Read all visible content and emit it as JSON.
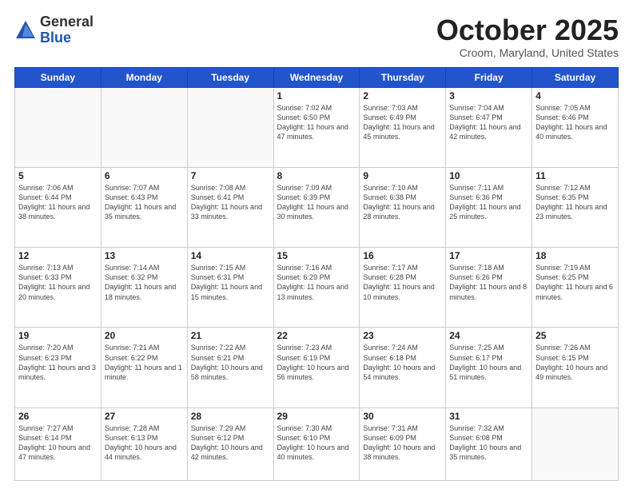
{
  "header": {
    "logo_general": "General",
    "logo_blue": "Blue",
    "title": "October 2025",
    "subtitle": "Croom, Maryland, United States"
  },
  "days_of_week": [
    "Sunday",
    "Monday",
    "Tuesday",
    "Wednesday",
    "Thursday",
    "Friday",
    "Saturday"
  ],
  "weeks": [
    [
      {
        "num": "",
        "info": ""
      },
      {
        "num": "",
        "info": ""
      },
      {
        "num": "",
        "info": ""
      },
      {
        "num": "1",
        "info": "Sunrise: 7:02 AM\nSunset: 6:50 PM\nDaylight: 11 hours and 47 minutes."
      },
      {
        "num": "2",
        "info": "Sunrise: 7:03 AM\nSunset: 6:49 PM\nDaylight: 11 hours and 45 minutes."
      },
      {
        "num": "3",
        "info": "Sunrise: 7:04 AM\nSunset: 6:47 PM\nDaylight: 11 hours and 42 minutes."
      },
      {
        "num": "4",
        "info": "Sunrise: 7:05 AM\nSunset: 6:46 PM\nDaylight: 11 hours and 40 minutes."
      }
    ],
    [
      {
        "num": "5",
        "info": "Sunrise: 7:06 AM\nSunset: 6:44 PM\nDaylight: 11 hours and 38 minutes."
      },
      {
        "num": "6",
        "info": "Sunrise: 7:07 AM\nSunset: 6:43 PM\nDaylight: 11 hours and 35 minutes."
      },
      {
        "num": "7",
        "info": "Sunrise: 7:08 AM\nSunset: 6:41 PM\nDaylight: 11 hours and 33 minutes."
      },
      {
        "num": "8",
        "info": "Sunrise: 7:09 AM\nSunset: 6:39 PM\nDaylight: 11 hours and 30 minutes."
      },
      {
        "num": "9",
        "info": "Sunrise: 7:10 AM\nSunset: 6:38 PM\nDaylight: 11 hours and 28 minutes."
      },
      {
        "num": "10",
        "info": "Sunrise: 7:11 AM\nSunset: 6:36 PM\nDaylight: 11 hours and 25 minutes."
      },
      {
        "num": "11",
        "info": "Sunrise: 7:12 AM\nSunset: 6:35 PM\nDaylight: 11 hours and 23 minutes."
      }
    ],
    [
      {
        "num": "12",
        "info": "Sunrise: 7:13 AM\nSunset: 6:33 PM\nDaylight: 11 hours and 20 minutes."
      },
      {
        "num": "13",
        "info": "Sunrise: 7:14 AM\nSunset: 6:32 PM\nDaylight: 11 hours and 18 minutes."
      },
      {
        "num": "14",
        "info": "Sunrise: 7:15 AM\nSunset: 6:31 PM\nDaylight: 11 hours and 15 minutes."
      },
      {
        "num": "15",
        "info": "Sunrise: 7:16 AM\nSunset: 6:29 PM\nDaylight: 11 hours and 13 minutes."
      },
      {
        "num": "16",
        "info": "Sunrise: 7:17 AM\nSunset: 6:28 PM\nDaylight: 11 hours and 10 minutes."
      },
      {
        "num": "17",
        "info": "Sunrise: 7:18 AM\nSunset: 6:26 PM\nDaylight: 11 hours and 8 minutes."
      },
      {
        "num": "18",
        "info": "Sunrise: 7:19 AM\nSunset: 6:25 PM\nDaylight: 11 hours and 6 minutes."
      }
    ],
    [
      {
        "num": "19",
        "info": "Sunrise: 7:20 AM\nSunset: 6:23 PM\nDaylight: 11 hours and 3 minutes."
      },
      {
        "num": "20",
        "info": "Sunrise: 7:21 AM\nSunset: 6:22 PM\nDaylight: 11 hours and 1 minute."
      },
      {
        "num": "21",
        "info": "Sunrise: 7:22 AM\nSunset: 6:21 PM\nDaylight: 10 hours and 58 minutes."
      },
      {
        "num": "22",
        "info": "Sunrise: 7:23 AM\nSunset: 6:19 PM\nDaylight: 10 hours and 56 minutes."
      },
      {
        "num": "23",
        "info": "Sunrise: 7:24 AM\nSunset: 6:18 PM\nDaylight: 10 hours and 54 minutes."
      },
      {
        "num": "24",
        "info": "Sunrise: 7:25 AM\nSunset: 6:17 PM\nDaylight: 10 hours and 51 minutes."
      },
      {
        "num": "25",
        "info": "Sunrise: 7:26 AM\nSunset: 6:15 PM\nDaylight: 10 hours and 49 minutes."
      }
    ],
    [
      {
        "num": "26",
        "info": "Sunrise: 7:27 AM\nSunset: 6:14 PM\nDaylight: 10 hours and 47 minutes."
      },
      {
        "num": "27",
        "info": "Sunrise: 7:28 AM\nSunset: 6:13 PM\nDaylight: 10 hours and 44 minutes."
      },
      {
        "num": "28",
        "info": "Sunrise: 7:29 AM\nSunset: 6:12 PM\nDaylight: 10 hours and 42 minutes."
      },
      {
        "num": "29",
        "info": "Sunrise: 7:30 AM\nSunset: 6:10 PM\nDaylight: 10 hours and 40 minutes."
      },
      {
        "num": "30",
        "info": "Sunrise: 7:31 AM\nSunset: 6:09 PM\nDaylight: 10 hours and 38 minutes."
      },
      {
        "num": "31",
        "info": "Sunrise: 7:32 AM\nSunset: 6:08 PM\nDaylight: 10 hours and 35 minutes."
      },
      {
        "num": "",
        "info": ""
      }
    ]
  ]
}
